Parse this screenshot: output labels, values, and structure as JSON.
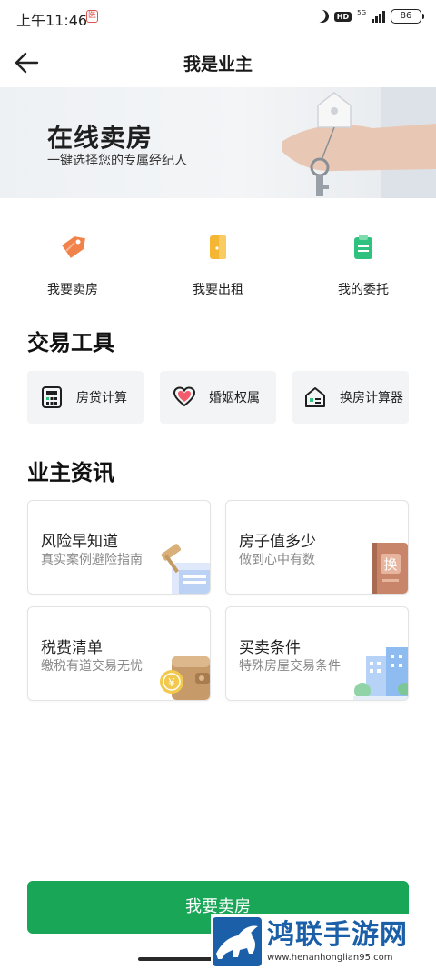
{
  "status_bar": {
    "time": "上午11:46",
    "notification_glyph": "医",
    "network": "5G",
    "battery": "86",
    "icons": [
      "moon-icon",
      "hd-icon",
      "signal-icon",
      "battery-icon"
    ]
  },
  "nav": {
    "title": "我是业主",
    "back_icon": "arrow-left-icon"
  },
  "banner": {
    "title": "在线卖房",
    "subtitle": "一键选择您的专属经纪人",
    "image": "hand-holding-house-key"
  },
  "quick_actions": [
    {
      "label": "我要卖房",
      "icon": "price-tag-icon",
      "color": "#f0824a"
    },
    {
      "label": "我要出租",
      "icon": "door-icon",
      "color": "#f5b733"
    },
    {
      "label": "我的委托",
      "icon": "clipboard-icon",
      "color": "#2ec27e"
    }
  ],
  "tools": {
    "title": "交易工具",
    "items": [
      {
        "label": "房贷计算",
        "icon": "calculator-icon"
      },
      {
        "label": "婚姻权属",
        "icon": "heart-icon"
      },
      {
        "label": "换房计算器",
        "icon": "house-calculator-icon"
      }
    ]
  },
  "owner_info": {
    "title": "业主资讯",
    "cards": [
      {
        "title": "风险早知道",
        "subtitle": "真实案例避险指南",
        "icon": "gavel-icon"
      },
      {
        "title": "房子值多少",
        "subtitle": "做到心中有数",
        "icon": "certificate-book-icon",
        "book_char": "换"
      },
      {
        "title": "税费清单",
        "subtitle": "缴税有道交易无忧",
        "icon": "wallet-coin-icon"
      },
      {
        "title": "买卖条件",
        "subtitle": "特殊房屋交易条件",
        "icon": "buildings-icon"
      }
    ]
  },
  "cta": {
    "label": "我要卖房",
    "color": "#1aa657"
  },
  "watermark": {
    "title": "鸿联手游网",
    "url": "www.henanhonglian95.com"
  }
}
